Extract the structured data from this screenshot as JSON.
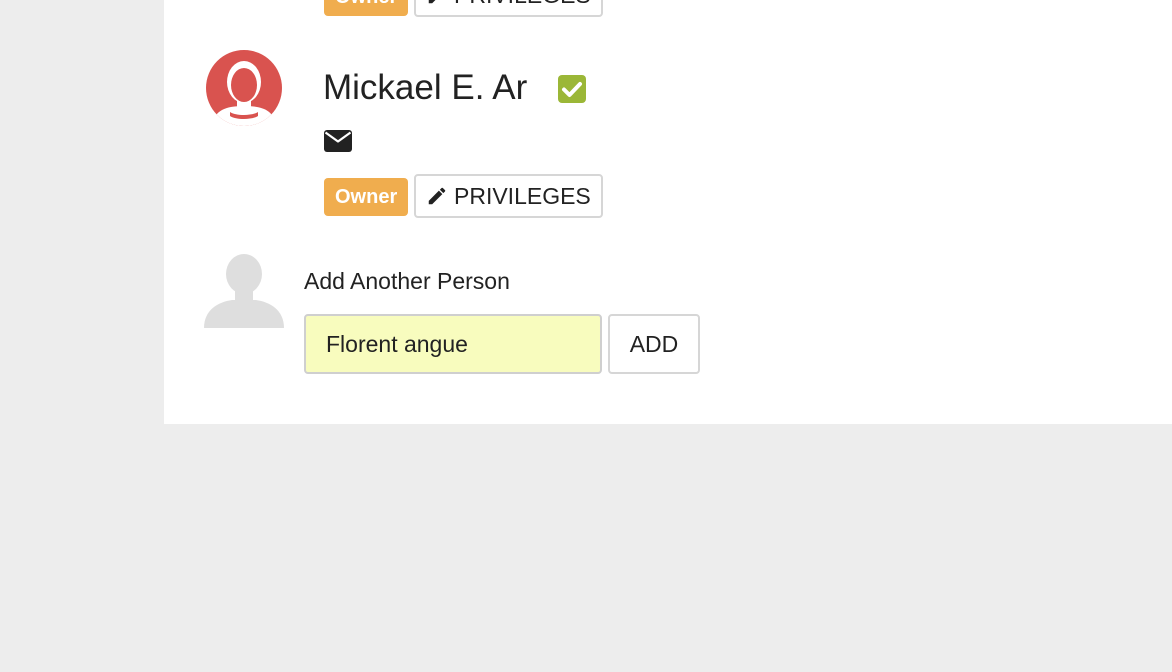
{
  "members": [
    {
      "name": "",
      "role_badge": "Owner",
      "privileges_label": "PRIVILEGES",
      "avatar_icon": "user-avatar-icon"
    },
    {
      "name": "Mickael E. Ar",
      "verified_icon": "check-square-icon",
      "email_icon": "envelope-icon",
      "role_badge": "Owner",
      "privileges_label": "PRIVILEGES",
      "avatar_icon": "user-avatar-icon"
    }
  ],
  "add_person": {
    "label": "Add Another Person",
    "input_value": "Florent angue",
    "button_label": "ADD",
    "placeholder_icon": "person-silhouette-icon"
  },
  "colors": {
    "background": "#ededed",
    "panel": "#ffffff",
    "owner_badge": "#f0ad4e",
    "avatar": "#d9534f",
    "verified": "#9bb737",
    "input_highlight": "#f8fcbe"
  }
}
